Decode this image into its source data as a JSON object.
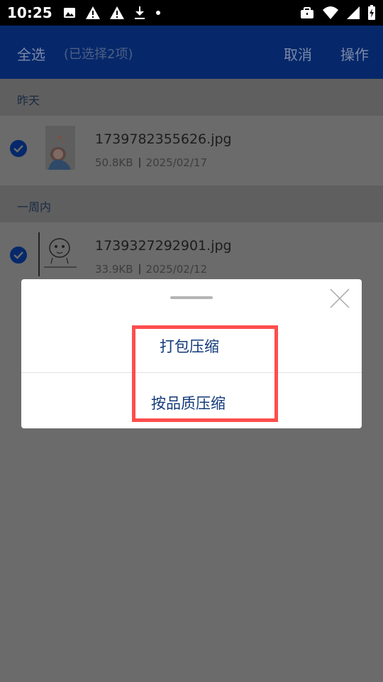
{
  "status_bar": {
    "time": "10:25",
    "left_icons": [
      "image-icon",
      "warning-icon",
      "warning-icon",
      "download-icon",
      "dot-icon"
    ],
    "right_icons": [
      "briefcase-icon",
      "wifi-icon",
      "signal-icon",
      "battery-icon"
    ]
  },
  "app_bar": {
    "select_all": "全选",
    "selected_count": "(已选择2项)",
    "cancel": "取消",
    "actions": "操作"
  },
  "sections": [
    {
      "header": "昨天",
      "files": [
        {
          "name": "1739782355626.jpg",
          "size": "50.8KB",
          "date": "2025/02/17",
          "checked": true,
          "thumb": "photo-thumbnail"
        }
      ]
    },
    {
      "header": "一周内",
      "files": [
        {
          "name": "1739327292901.jpg",
          "size": "33.9KB",
          "date": "2025/02/12",
          "checked": true,
          "thumb": "sketch-thumbnail"
        }
      ]
    }
  ],
  "dialog": {
    "options": [
      "打包压缩",
      "按品质压缩"
    ]
  },
  "colors": {
    "app_bar": "#06286a",
    "overlay": "#6b6b6b",
    "option_text": "#133a7a",
    "highlight": "#ff4d4d"
  }
}
